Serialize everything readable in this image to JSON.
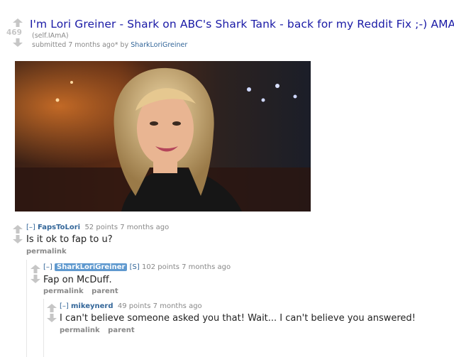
{
  "post": {
    "title": "I'm Lori Greiner - Shark on ABC's Shark Tank - back for my Reddit Fix ;-) AMA!",
    "score": "469",
    "domain": "(self.IAmA)",
    "submitted_prefix": "submitted 7 months ago* by",
    "author": "SharkLoriGreiner",
    "image_name": "photo-of-lori-greiner"
  },
  "comments": [
    {
      "collapse": "[–]",
      "user": "FapsToLori",
      "meta": "52 points 7 months ago",
      "body": "Is it ok to fap to u?",
      "links": [
        "permalink"
      ]
    },
    {
      "collapse": "[–]",
      "user": "SharkLoriGreiner",
      "flag": "[S]",
      "meta": "102 points 7 months ago",
      "body": "Fap on McDuff.",
      "links": [
        "permalink",
        "parent"
      ]
    },
    {
      "collapse": "[–]",
      "user": "mikeynerd",
      "meta": "49 points 7 months ago",
      "body": "I can't believe someone asked you that! Wait... I can't believe you answered!",
      "links": [
        "permalink",
        "parent"
      ]
    }
  ],
  "colors": {
    "title_link": "#1a1aa6",
    "username": "#336699",
    "op_badge": "#5f99cf",
    "vote_arrow": "#c6c6c6"
  }
}
